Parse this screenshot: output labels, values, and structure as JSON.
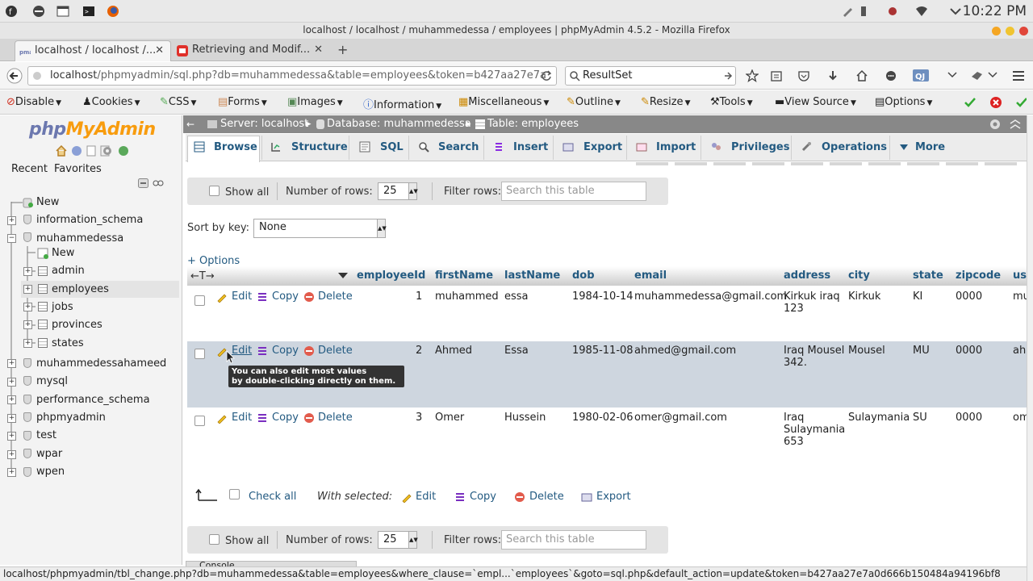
{
  "system": {
    "clock": "10:22 PM"
  },
  "window": {
    "title": "localhost / localhost / muhammedessa / employees | phpMyAdmin 4.5.2 - Mozilla Firefox"
  },
  "tabs": [
    {
      "label": "localhost / localhost /...",
      "close": "✕"
    },
    {
      "label": "Retrieving and Modif...",
      "close": "✕"
    }
  ],
  "new_tab": "+",
  "nav": {
    "url_host": "localhost",
    "url_path": "/phpmyadmin/sql.php?db=muhammedessa&table=employees&token=b427aa27e7a",
    "search_value": "ResultSet"
  },
  "webdev": {
    "items": [
      "Disable",
      "Cookies",
      "CSS",
      "Forms",
      "Images",
      "Information",
      "Miscellaneous",
      "Outline",
      "Resize",
      "Tools",
      "View Source",
      "Options"
    ]
  },
  "sidebar": {
    "logo_php": "php",
    "logo_myadmin": "MyAdmin",
    "recent": "Recent",
    "favorites": "Favorites",
    "tree": {
      "new": "New",
      "information_schema": "information_schema",
      "muhammedessa": "muhammedessa",
      "sub_new": "New",
      "admin": "admin",
      "employees": "employees",
      "jobs": "jobs",
      "provinces": "provinces",
      "states": "states",
      "muhammedessahameed": "muhammedessahameed",
      "mysql": "mysql",
      "performance_schema": "performance_schema",
      "phpmyadmin": "phpmyadmin",
      "test": "test",
      "wpar": "wpar",
      "wpen": "wpen"
    }
  },
  "breadcrumb": {
    "server": "Server: localhost",
    "database": "Database: muhammedessa",
    "table": "Table: employees"
  },
  "topmenu": [
    "Browse",
    "Structure",
    "SQL",
    "Search",
    "Insert",
    "Export",
    "Import",
    "Privileges",
    "Operations",
    "More"
  ],
  "navigation": {
    "show_all": "Show all",
    "rows_label": "Number of rows:",
    "rows_value": "25",
    "filter_label": "Filter rows:",
    "filter_placeholder": "Search this table",
    "sort_label": "Sort by key:",
    "sort_value": "None",
    "options": "+ Options"
  },
  "table": {
    "columns": [
      "employeeId",
      "firstName",
      "lastName",
      "dob",
      "email",
      "address",
      "city",
      "state",
      "zipcode",
      "us"
    ],
    "actions": {
      "edit": "Edit",
      "copy": "Copy",
      "delete": "Delete"
    },
    "rows": [
      {
        "employeeId": "1",
        "firstName": "muhammed",
        "lastName": "essa",
        "dob": "1984-10-14",
        "email": "muhammedessa@gmail.com",
        "address": [
          "Kirkuk iraq",
          "123"
        ],
        "city": "Kirkuk",
        "state": "KI",
        "zipcode": "0000",
        "us": "mu"
      },
      {
        "employeeId": "2",
        "firstName": "Ahmed",
        "lastName": "Essa",
        "dob": "1985-11-08",
        "email": "ahmed@gmail.com",
        "address": [
          "Iraq Mousel",
          "342."
        ],
        "city": "Mousel",
        "state": "MU",
        "zipcode": "0000",
        "us": "ah"
      },
      {
        "employeeId": "3",
        "firstName": "Omer",
        "lastName": "Hussein",
        "dob": "1980-02-06",
        "email": "omer@gmail.com",
        "address": [
          "Iraq",
          "Sulaymania",
          "653"
        ],
        "city": "Sulaymania",
        "state": "SU",
        "zipcode": "0000",
        "us": "om"
      }
    ]
  },
  "tooltip": {
    "line1": "You can also edit most values",
    "line2": "by double-clicking directly on them."
  },
  "bulk": {
    "check_all": "Check all",
    "with_selected": "With selected:",
    "edit": "Edit",
    "copy": "Copy",
    "delete": "Delete",
    "export": "Export"
  },
  "console": "Console",
  "status_url": "localhost/phpmyadmin/tbl_change.php?db=muhammedessa&table=employees&where_clause=`empl...`employees`&goto=sql.php&default_action=update&token=b427aa27e7a0d666b150484a94196bf8"
}
